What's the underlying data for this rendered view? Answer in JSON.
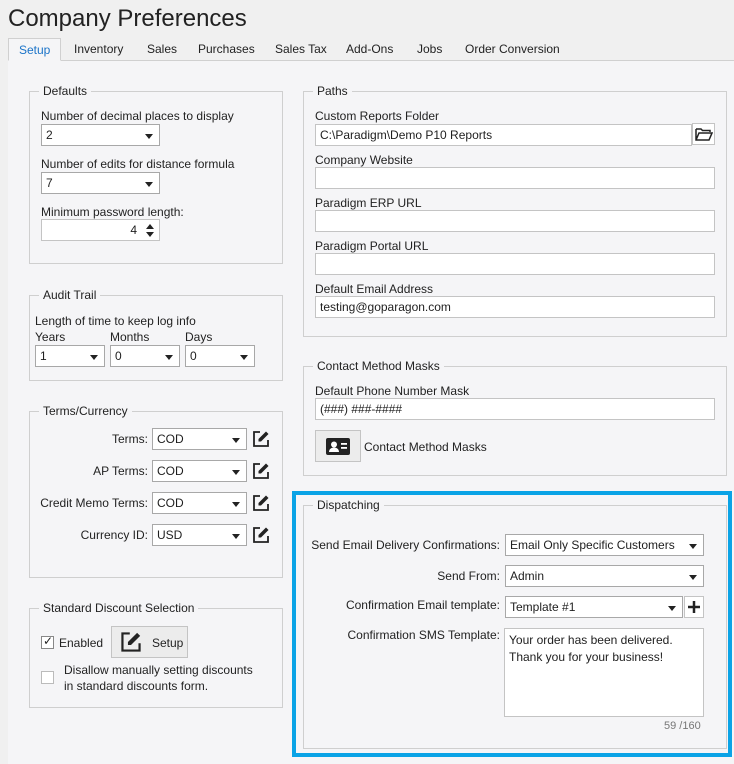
{
  "window": {
    "title": "Company Preferences"
  },
  "tabs": [
    {
      "label": "Setup"
    },
    {
      "label": "Inventory"
    },
    {
      "label": "Sales"
    },
    {
      "label": "Purchases"
    },
    {
      "label": "Sales Tax"
    },
    {
      "label": "Add-Ons"
    },
    {
      "label": "Jobs"
    },
    {
      "label": "Order Conversion"
    }
  ],
  "defaults": {
    "legend": "Defaults",
    "decimal_label": "Number of decimal places to display",
    "decimal_value": "2",
    "edits_label": "Number of edits for distance formula",
    "edits_value": "7",
    "password_label": "Minimum password length:",
    "password_value": "4"
  },
  "audit": {
    "legend": "Audit Trail",
    "description": "Length of time to keep log info",
    "years_label": "Years",
    "years_value": "1",
    "months_label": "Months",
    "months_value": "0",
    "days_label": "Days",
    "days_value": "0"
  },
  "terms": {
    "legend": "Terms/Currency",
    "terms_label": "Terms:",
    "terms_value": "COD",
    "ap_label": "AP Terms:",
    "ap_value": "COD",
    "credit_label": "Credit Memo Terms:",
    "credit_value": "COD",
    "currency_label": "Currency ID:",
    "currency_value": "USD"
  },
  "discount": {
    "legend": "Standard Discount Selection",
    "enabled_label": "Enabled",
    "enabled_checked": true,
    "setup_label": "Setup",
    "disallow_line1": "Disallow manually setting discounts",
    "disallow_line2": "in standard discounts form.",
    "disallow_checked": false
  },
  "paths": {
    "legend": "Paths",
    "reports_label": "Custom Reports Folder",
    "reports_value": "C:\\Paradigm\\Demo P10 Reports",
    "website_label": "Company Website",
    "website_value": "",
    "erp_label": "Paradigm ERP URL",
    "erp_value": "",
    "portal_label": "Paradigm Portal URL",
    "portal_value": "",
    "email_label": "Default Email Address",
    "email_value": "testing@goparagon.com"
  },
  "contact": {
    "legend": "Contact Method Masks",
    "phone_label": "Default Phone Number Mask",
    "phone_value": "(###) ###-####",
    "masks_button_label": "Contact Method Masks"
  },
  "dispatching": {
    "legend": "Dispatching",
    "delivery_label": "Send Email Delivery Confirmations:",
    "delivery_value": "Email Only Specific Customers",
    "sendfrom_label": "Send From:",
    "sendfrom_value": "Admin",
    "template_label": "Confirmation Email template:",
    "template_value": "Template #1",
    "sms_label": "Confirmation SMS Template:",
    "sms_line1": "Your order has been delivered.",
    "sms_line2": "Thank you for your business!",
    "sms_counter": "59 /160"
  },
  "colors": {
    "active_tab_text": "#1a73c8",
    "highlight_border": "#0aa3e6"
  }
}
